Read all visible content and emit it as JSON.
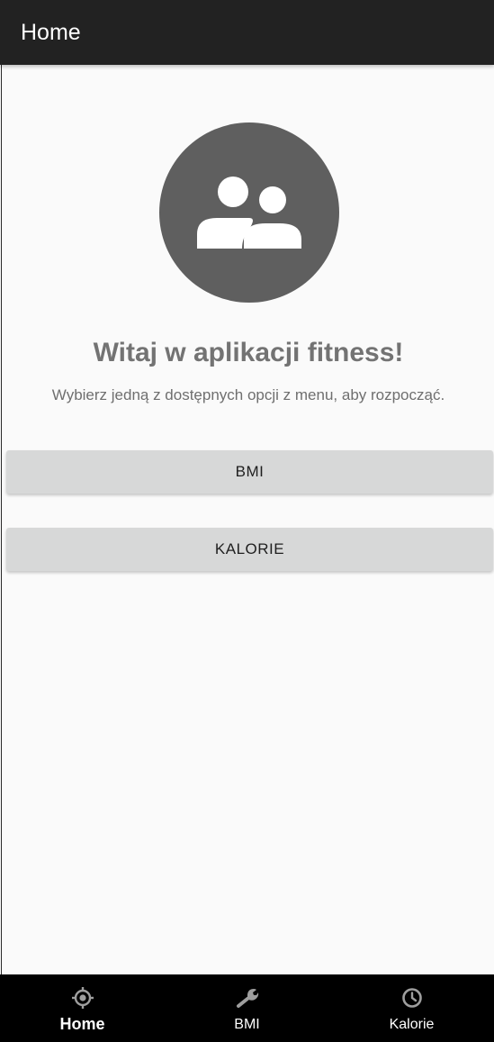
{
  "app_bar": {
    "title": "Home"
  },
  "main": {
    "avatar_icon": "group-people-icon",
    "welcome_title": "Witaj w aplikacji fitness!",
    "welcome_subtitle": "Wybierz jedną z dostępnych opcji z menu, aby rozpocząć.",
    "buttons": [
      {
        "label": "BMI"
      },
      {
        "label": "KALORIE"
      }
    ]
  },
  "bottom_nav": {
    "items": [
      {
        "label": "Home",
        "icon": "target-icon",
        "active": true
      },
      {
        "label": "BMI",
        "icon": "wrench-icon",
        "active": false
      },
      {
        "label": "Kalorie",
        "icon": "clock-icon",
        "active": false
      }
    ]
  },
  "colors": {
    "app_bar_bg": "#222222",
    "background": "#fafafa",
    "avatar_bg": "#5f5f5f",
    "button_bg": "#d7d8d8",
    "nav_bg": "#000000",
    "title_text": "#737373"
  }
}
